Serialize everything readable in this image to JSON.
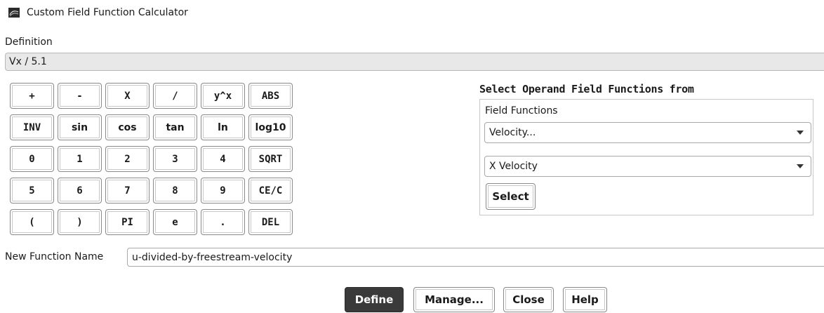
{
  "window": {
    "title": "Custom Field Function Calculator",
    "icon": "fluent-app-icon"
  },
  "definition": {
    "label": "Definition",
    "value": "Vx / 5.1"
  },
  "keypad": {
    "rows": [
      [
        "+",
        "-",
        "X",
        "/",
        "y^x",
        "ABS"
      ],
      [
        "INV",
        "sin",
        "cos",
        "tan",
        "ln",
        "log10"
      ],
      [
        "0",
        "1",
        "2",
        "3",
        "4",
        "SQRT"
      ],
      [
        "5",
        "6",
        "7",
        "8",
        "9",
        "CE/C"
      ],
      [
        "(",
        ")",
        "PI",
        "e",
        ".",
        "DEL"
      ]
    ]
  },
  "operand": {
    "title": "Select Operand Field Functions from",
    "field_functions_label": "Field Functions",
    "category_value": "Velocity...",
    "function_value": "X Velocity",
    "select_label": "Select"
  },
  "new_function": {
    "label": "New Function Name",
    "value": "u-divided-by-freestream-velocity"
  },
  "footer": {
    "define": "Define",
    "manage": "Manage...",
    "close": "Close",
    "help": "Help"
  },
  "colors": {
    "primary_button": "#3a3a3a",
    "definition_bg": "#e8e8e8"
  }
}
